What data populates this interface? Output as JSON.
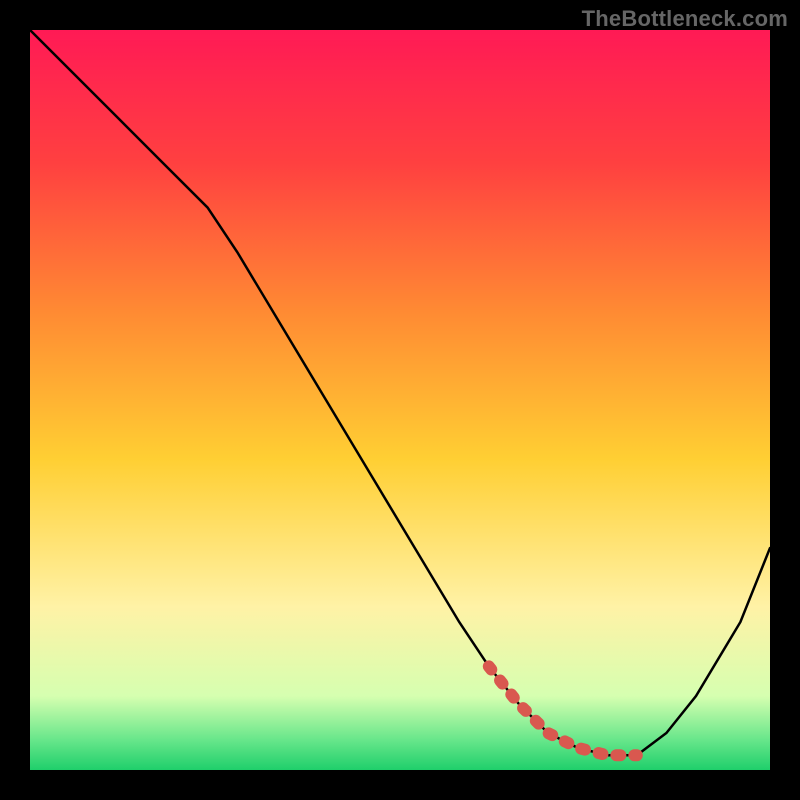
{
  "watermark": "TheBottleneck.com",
  "chart_data": {
    "type": "line",
    "title": "",
    "xlabel": "",
    "ylabel": "",
    "xlim": [
      0,
      100
    ],
    "ylim": [
      0,
      100
    ],
    "grid": false,
    "background_gradient": {
      "top": "#ff1a4d",
      "upper_mid": "#ff7a33",
      "mid": "#ffd633",
      "lower_mid": "#fff2b3",
      "bottom": "#1fcf6b"
    },
    "series": [
      {
        "name": "bottleneck-curve",
        "color": "#000000",
        "style": "solid",
        "x": [
          0,
          6,
          12,
          18,
          24,
          28,
          34,
          40,
          46,
          52,
          58,
          62,
          66,
          70,
          74,
          78,
          82,
          86,
          90,
          96,
          100
        ],
        "y": [
          100,
          94,
          88,
          82,
          76,
          70,
          60,
          50,
          40,
          30,
          20,
          14,
          9,
          5,
          3,
          2,
          2,
          5,
          10,
          20,
          30
        ]
      },
      {
        "name": "highlight-segment",
        "color": "#d9584f",
        "style": "thick-dashed",
        "x": [
          62,
          66,
          70,
          74,
          78,
          82
        ],
        "y": [
          14,
          9,
          5,
          3,
          2,
          2
        ]
      }
    ]
  }
}
